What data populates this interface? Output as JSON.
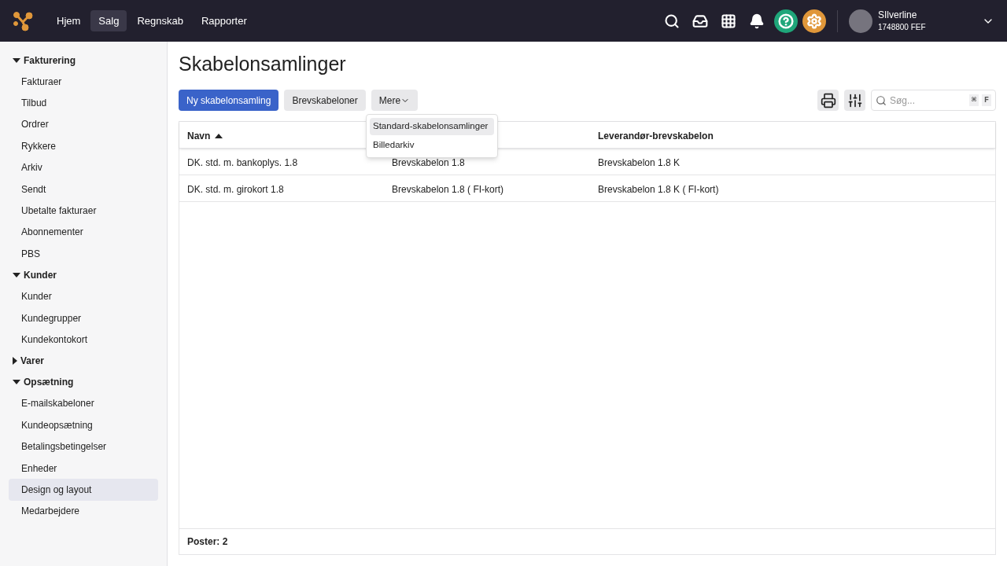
{
  "nav": {
    "tabs": [
      {
        "label": "Hjem",
        "selected": false
      },
      {
        "label": "Salg",
        "selected": true
      },
      {
        "label": "Regnskab",
        "selected": false
      },
      {
        "label": "Rapporter",
        "selected": false
      }
    ],
    "user": {
      "name": "SIlverline",
      "account": "1748800 FEF"
    }
  },
  "sidebar": {
    "sections": [
      {
        "label": "Fakturering",
        "expanded": true,
        "items": [
          {
            "label": "Fakturaer",
            "selected": false
          },
          {
            "label": "Tilbud",
            "selected": false
          },
          {
            "label": "Ordrer",
            "selected": false
          },
          {
            "label": "Rykkere",
            "selected": false
          },
          {
            "label": "Arkiv",
            "selected": false
          },
          {
            "label": "Sendt",
            "selected": false
          },
          {
            "label": "Ubetalte fakturaer",
            "selected": false
          },
          {
            "label": "Abonnementer",
            "selected": false
          },
          {
            "label": "PBS",
            "selected": false
          }
        ]
      },
      {
        "label": "Kunder",
        "expanded": true,
        "items": [
          {
            "label": "Kunder",
            "selected": false
          },
          {
            "label": "Kundegrupper",
            "selected": false
          },
          {
            "label": "Kundekontokort",
            "selected": false
          }
        ]
      },
      {
        "label": "Varer",
        "expanded": false
      },
      {
        "label": "Opsætning",
        "expanded": true,
        "items": [
          {
            "label": "E-mailskabeloner",
            "selected": false
          },
          {
            "label": "Kundeopsætning",
            "selected": false
          },
          {
            "label": "Betalingsbetingelser",
            "selected": false
          },
          {
            "label": "Enheder",
            "selected": false
          },
          {
            "label": "Design og layout",
            "selected": true
          },
          {
            "label": "Medarbejdere",
            "selected": false
          }
        ]
      }
    ]
  },
  "page": {
    "title": "Skabelonsamlinger",
    "buttons": [
      {
        "label": "Ny skabelonsamling",
        "kind": "primary"
      },
      {
        "label": "Brevskabeloner",
        "kind": "secondary"
      },
      {
        "label": "Mere",
        "kind": "dropdown"
      }
    ],
    "menu": {
      "items": [
        {
          "label": "Standard-skabelonsamlinger",
          "selected": true
        },
        {
          "label": "Billedarkiv",
          "selected": false
        }
      ]
    },
    "search": {
      "placeholder": "Søg...",
      "shortcut": [
        "⌘",
        "F"
      ]
    },
    "table": {
      "columns": [
        {
          "label": "Navn",
          "sorted": true
        },
        null,
        {
          "label": "Leverandør-brevskabelon",
          "sorted": false
        }
      ],
      "rows": [
        [
          "DK. std. m. bankoplys. 1.8",
          "Brevskabelon 1.8",
          "Brevskabelon 1.8 K"
        ],
        [
          "DK. std. m. girokort 1.8",
          "Brevskabelon 1.8 ( FI-kort)",
          "Brevskabelon 1.8 K ( FI-kort)"
        ]
      ],
      "footer": "Poster: 2"
    }
  }
}
